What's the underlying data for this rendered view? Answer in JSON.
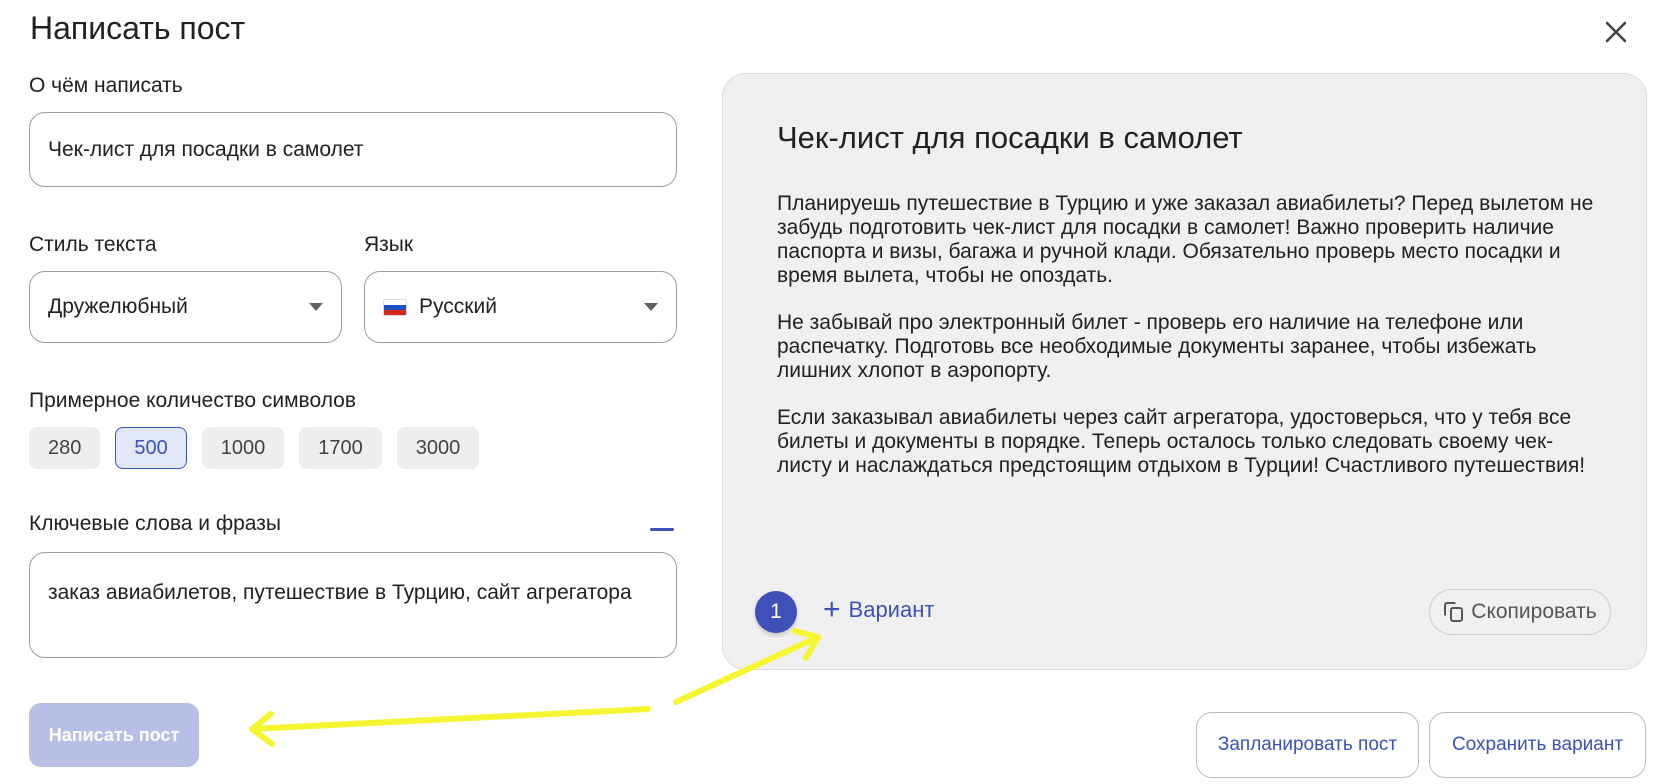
{
  "header": {
    "title": "Написать пост"
  },
  "form": {
    "topic": {
      "label": "О чём написать",
      "value": "Чек-лист для посадки в самолет"
    },
    "style": {
      "label": "Стиль текста",
      "value": "Дружелюбный"
    },
    "language": {
      "label": "Язык",
      "value": "Русский",
      "flag": "russia-flag-icon"
    },
    "length": {
      "label": "Примерное количество символов",
      "options": [
        "280",
        "500",
        "1000",
        "1700",
        "3000"
      ],
      "selected": "500"
    },
    "keywords": {
      "label": "Ключевые слова и фразы",
      "value": "заказ авиабилетов, путешествие в Турцию, сайт агрегатора"
    },
    "submit_label": "Написать пост"
  },
  "preview": {
    "title": "Чек-лист для посадки в самолет",
    "paragraphs": [
      "Планируешь путешествие в Турцию и уже заказал авиабилеты? Перед вылетом не забудь подготовить чек-лист для посадки в самолет! Важно проверить наличие паспорта и визы, багажа и ручной клади. Обязательно проверь место посадки и время вылета, чтобы не опоздать.",
      "Не забывай про электронный билет - проверь его наличие на телефоне или распечатку. Подготовь все необходимые документы заранее, чтобы избежать лишних хлопот в аэропорту.",
      "Если заказывал авиабилеты через сайт агрегатора, удостоверься, что у тебя все билеты и документы в порядке. Теперь осталось только следовать своему чек-листу и наслаждаться предстоящим отдыхом в Турции! Счастливого путешествия!"
    ],
    "variant_number": "1",
    "add_variant_label": "Вариант",
    "copy_label": "Скопировать"
  },
  "footer": {
    "schedule_label": "Запланировать пост",
    "save_label": "Сохранить вариант"
  },
  "colors": {
    "accent": "#3d51b8",
    "disabled_button": "#b7bfe6",
    "annotation_arrow": "#f5f532"
  }
}
